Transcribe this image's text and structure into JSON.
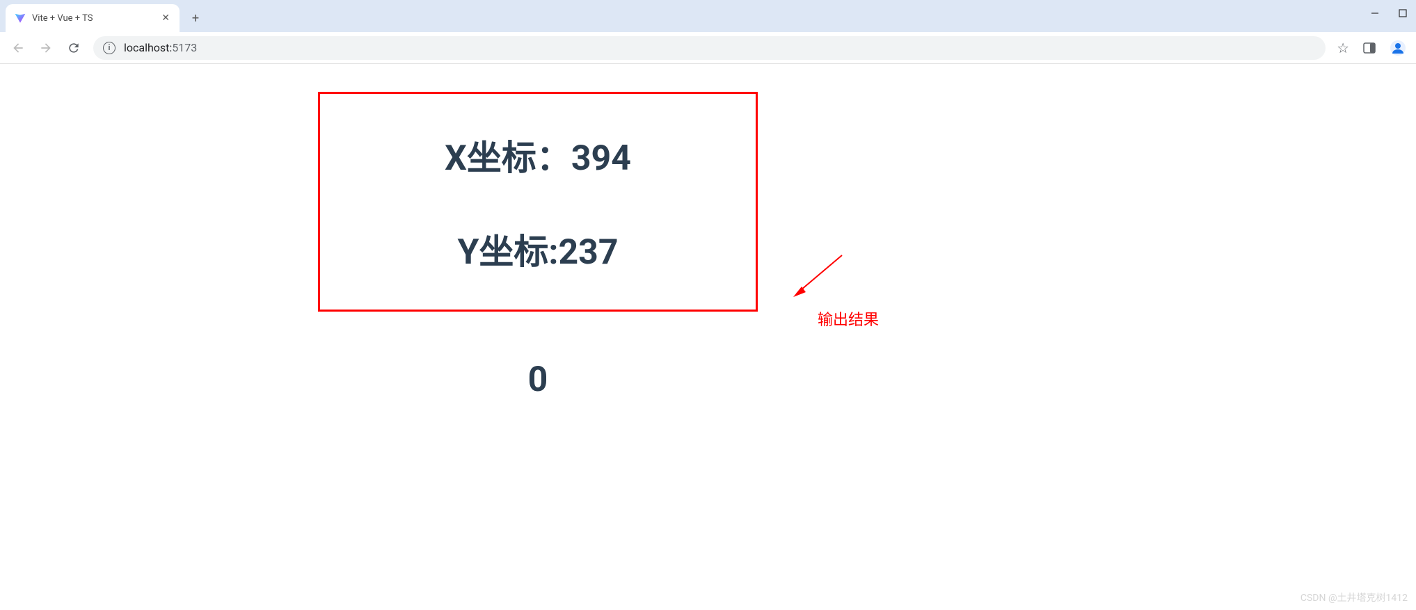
{
  "browser": {
    "tab": {
      "title": "Vite + Vue + TS"
    },
    "url": {
      "domain": "localhost:",
      "port": "5173"
    }
  },
  "page": {
    "x_label": "X坐标：",
    "x_value": "394",
    "y_label": "Y坐标:",
    "y_value": "237",
    "zero": "0"
  },
  "annotation": {
    "label": "输出结果"
  },
  "watermark": "CSDN @土井塔克树1412"
}
